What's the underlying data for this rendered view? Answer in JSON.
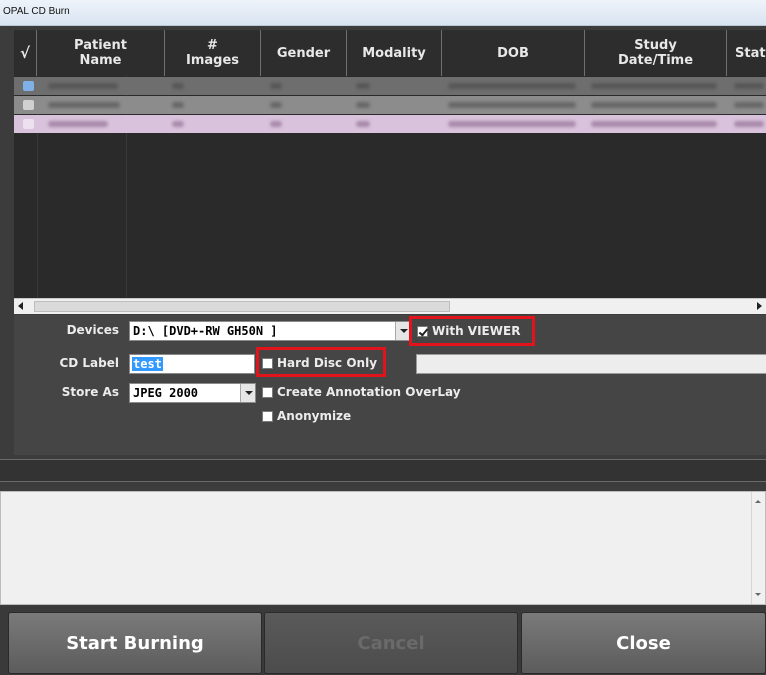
{
  "window": {
    "title": "OPAL CD Burn"
  },
  "grid": {
    "columns": [
      "√",
      "Patient\nName",
      "#\nImages",
      "Gender",
      "Modality",
      "DOB",
      "Study\nDate/Time",
      "Stat"
    ]
  },
  "settings": {
    "devices_label": "Devices",
    "devices_value": "D:\\ [DVD+-RW GH50N  ]",
    "with_viewer_label": "With VIEWER",
    "cd_label_label": "CD Label",
    "cd_label_value": "test",
    "hard_disc_only_label": "Hard Disc Only",
    "store_as_label": "Store As",
    "store_as_value": "JPEG 2000",
    "annotation_label": "Create Annotation OverLay",
    "anonymize_label": "Anonymize"
  },
  "buttons": {
    "start": "Start Burning",
    "cancel": "Cancel",
    "close": "Close"
  },
  "colors": {
    "highlight_red": "#e0141a",
    "selection_blue": "#3399ff"
  }
}
